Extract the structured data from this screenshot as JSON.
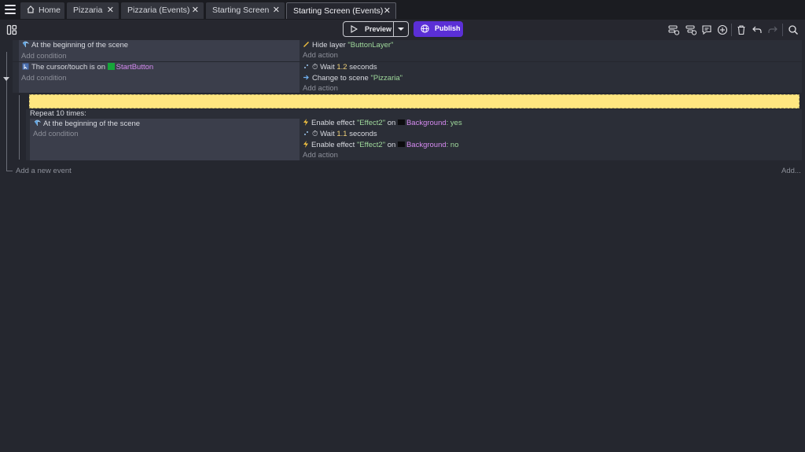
{
  "tabs": [
    {
      "label": "Home"
    },
    {
      "label": "Pizzaria"
    },
    {
      "label": "Pizzaria (Events)"
    },
    {
      "label": "Starting Screen"
    },
    {
      "label": "Starting Screen (Events)"
    }
  ],
  "toolbar": {
    "preview_label": "Preview",
    "publish_label": "Publish"
  },
  "events": {
    "e1": {
      "condition": "At the beginning of the scene",
      "add_condition": "Add condition",
      "action_prefix": "Hide layer",
      "action_layer": "\"ButtonLayer\"",
      "add_action": "Add action"
    },
    "e2": {
      "condition_prefix": "The cursor/touch is on",
      "condition_object": "StartButton",
      "add_condition": "Add condition",
      "wait_label": "Wait",
      "wait_value": "1.2",
      "wait_unit": "seconds",
      "change_label": "Change to scene",
      "change_scene": "\"Pizzaria\"",
      "add_action": "Add action"
    },
    "repeat": {
      "label": "Repeat 10 times:",
      "condition": "At the beginning of the scene",
      "add_condition": "Add condition",
      "a1_label": "Enable effect",
      "a1_effect": "\"Effect2\"",
      "a1_on": "on",
      "a1_object": "Background",
      "a1_value": ": yes",
      "a2_label": "Wait",
      "a2_value": "1.1",
      "a2_unit": "seconds",
      "a3_label": "Enable effect",
      "a3_effect": "\"Effect2\"",
      "a3_on": "on",
      "a3_object": "Background",
      "a3_value": ": no",
      "add_action": "Add action"
    },
    "add_new_event": "Add a new event",
    "add_more": "Add..."
  },
  "colors": {
    "accent": "#5b2fd6",
    "comment": "#ffe680",
    "string": "#9fd89b",
    "number": "#f1d27a",
    "object": "#d58af0"
  }
}
